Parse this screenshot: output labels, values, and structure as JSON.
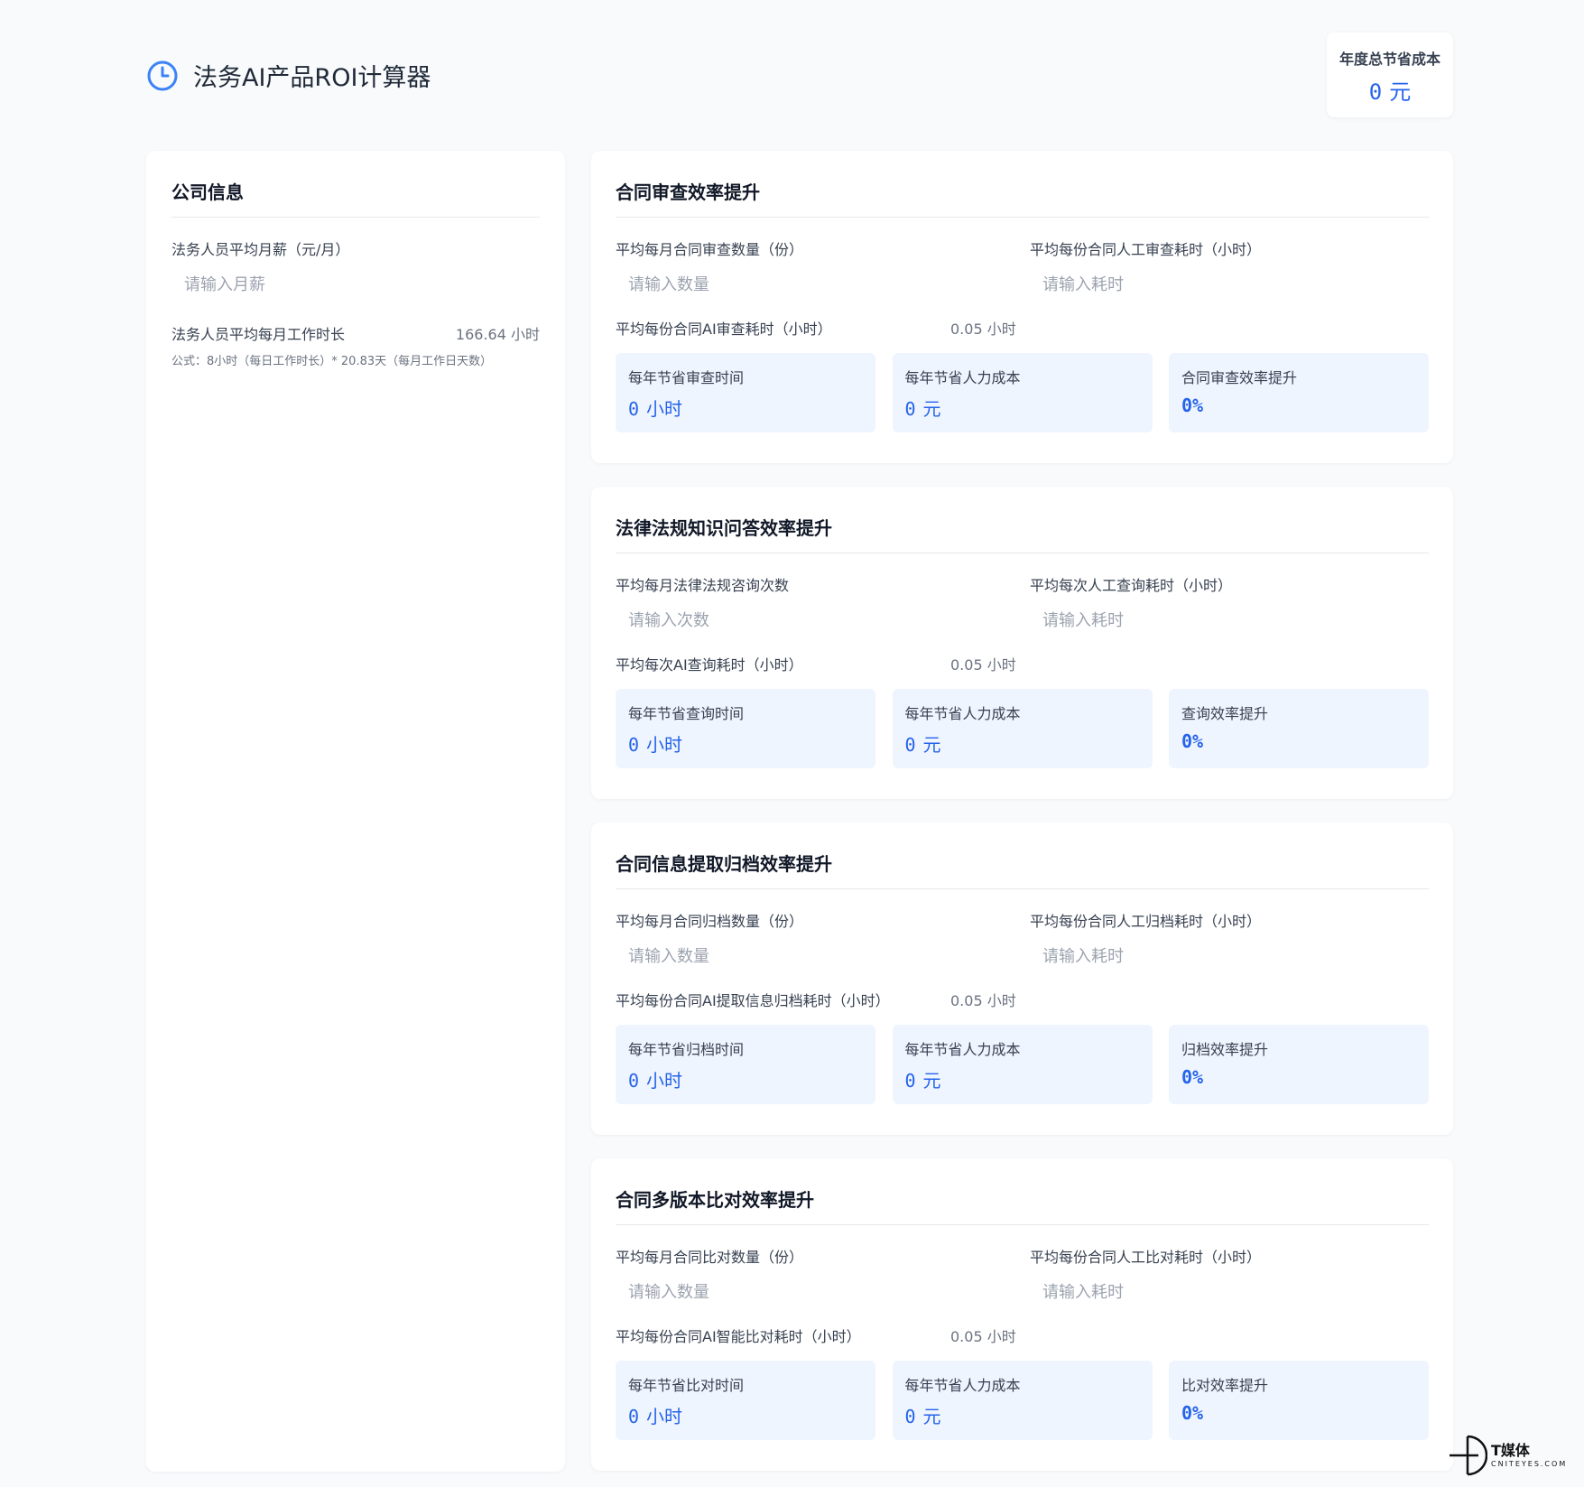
{
  "header": {
    "title": "法务AI产品ROI计算器",
    "total_label": "年度总节省成本",
    "total_value": "0",
    "total_unit": "元"
  },
  "company": {
    "title": "公司信息",
    "salary_label": "法务人员平均月薪（元/月）",
    "salary_placeholder": "请输入月薪",
    "hours_label": "法务人员平均每月工作时长",
    "hours_value": "166.64 小时",
    "formula": "公式：8小时（每日工作时长）* 20.83天（每月工作日天数）"
  },
  "sections": [
    {
      "title": "合同审查效率提升",
      "input1_label": "平均每月合同审查数量（份）",
      "input1_placeholder": "请输入数量",
      "input2_label": "平均每份合同人工审查耗时（小时）",
      "input2_placeholder": "请输入耗时",
      "ai_label": "平均每份合同AI审查耗时（小时）",
      "ai_value": "0.05 小时",
      "time_label": "每年节省审查时间",
      "time_value": "0",
      "time_unit": "小时",
      "cost_label": "每年节省人力成本",
      "cost_value": "0",
      "cost_unit": "元",
      "eff_label": "合同审查效率提升",
      "eff_value": "0%"
    },
    {
      "title": "法律法规知识问答效率提升",
      "input1_label": "平均每月法律法规咨询次数",
      "input1_placeholder": "请输入次数",
      "input2_label": "平均每次人工查询耗时（小时）",
      "input2_placeholder": "请输入耗时",
      "ai_label": "平均每次AI查询耗时（小时）",
      "ai_value": "0.05 小时",
      "time_label": "每年节省查询时间",
      "time_value": "0",
      "time_unit": "小时",
      "cost_label": "每年节省人力成本",
      "cost_value": "0",
      "cost_unit": "元",
      "eff_label": "查询效率提升",
      "eff_value": "0%"
    },
    {
      "title": "合同信息提取归档效率提升",
      "input1_label": "平均每月合同归档数量（份）",
      "input1_placeholder": "请输入数量",
      "input2_label": "平均每份合同人工归档耗时（小时）",
      "input2_placeholder": "请输入耗时",
      "ai_label": "平均每份合同AI提取信息归档耗时（小时）",
      "ai_value": "0.05 小时",
      "time_label": "每年节省归档时间",
      "time_value": "0",
      "time_unit": "小时",
      "cost_label": "每年节省人力成本",
      "cost_value": "0",
      "cost_unit": "元",
      "eff_label": "归档效率提升",
      "eff_value": "0%"
    },
    {
      "title": "合同多版本比对效率提升",
      "input1_label": "平均每月合同比对数量（份）",
      "input1_placeholder": "请输入数量",
      "input2_label": "平均每份合同人工比对耗时（小时）",
      "input2_placeholder": "请输入耗时",
      "ai_label": "平均每份合同AI智能比对耗时（小时）",
      "ai_value": "0.05 小时",
      "time_label": "每年节省比对时间",
      "time_value": "0",
      "time_unit": "小时",
      "cost_label": "每年节省人力成本",
      "cost_value": "0",
      "cost_unit": "元",
      "eff_label": "比对效率提升",
      "eff_value": "0%"
    }
  ],
  "watermark": {
    "main": "T媒体",
    "sub": "CNITEYES.COM"
  },
  "colors": {
    "accent": "#2563eb",
    "metric_bg": "#eff5fe",
    "page_bg": "#f8fafc"
  },
  "icons": {
    "title": "clock-icon"
  }
}
